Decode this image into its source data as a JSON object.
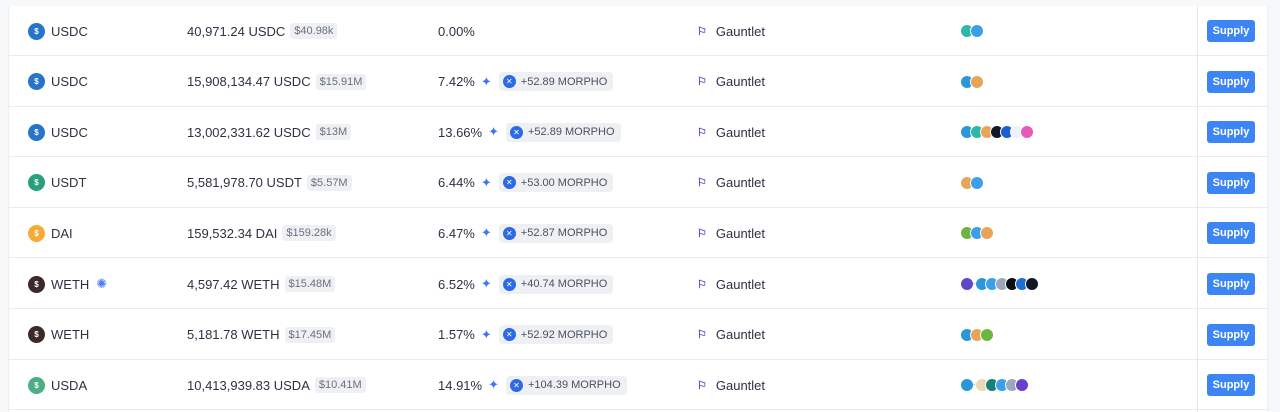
{
  "colors": {
    "accent": "#3d85f4",
    "usdc": "#2775ca",
    "usdt": "#26a17b",
    "dai": "#f5ac37",
    "weth": "#3c2a2a",
    "usda": "#4cae85",
    "morpho": "#2e6ae5",
    "curator": "#5a52d6"
  },
  "rows": [
    {
      "asset": {
        "symbol": "USDC",
        "icon": "usdc-icon",
        "color": "#2775ca",
        "extra_icon": null
      },
      "deposit": {
        "amount": "40,971.24 USDC",
        "usd": "$40.98k"
      },
      "apy": {
        "value": "0.00%",
        "sparkle": false,
        "reward": null
      },
      "curator": {
        "icon": "gauntlet-icon",
        "name": "Gauntlet"
      },
      "collateral": {
        "icons": [
          "#2fb7a7",
          "#3aa0ea"
        ],
        "more": false
      },
      "action_label": "Supply"
    },
    {
      "asset": {
        "symbol": "USDC",
        "icon": "usdc-icon",
        "color": "#2775ca",
        "extra_icon": null
      },
      "deposit": {
        "amount": "15,908,134.47 USDC",
        "usd": "$15.91M"
      },
      "apy": {
        "value": "7.42%",
        "sparkle": true,
        "reward": "+52.89 MORPHO"
      },
      "curator": {
        "icon": "gauntlet-icon",
        "name": "Gauntlet"
      },
      "collateral": {
        "icons": [
          "#2a97d8",
          "#e8a55a"
        ],
        "more": false
      },
      "action_label": "Supply"
    },
    {
      "asset": {
        "symbol": "USDC",
        "icon": "usdc-icon",
        "color": "#2775ca",
        "extra_icon": null
      },
      "deposit": {
        "amount": "13,002,331.62 USDC",
        "usd": "$13M"
      },
      "apy": {
        "value": "13.66%",
        "sparkle": true,
        "reward": "+52.89 MORPHO"
      },
      "curator": {
        "icon": "gauntlet-icon",
        "name": "Gauntlet"
      },
      "collateral": {
        "icons": [
          "#2a97d8",
          "#2fb7a7",
          "#e8a55a",
          "#101826",
          "#1d5fd1",
          "#eef3fb",
          "#e85ab8"
        ],
        "more": false
      },
      "action_label": "Supply"
    },
    {
      "asset": {
        "symbol": "USDT",
        "icon": "usdt-icon",
        "color": "#26a17b",
        "extra_icon": null
      },
      "deposit": {
        "amount": "5,581,978.70 USDT",
        "usd": "$5.57M"
      },
      "apy": {
        "value": "6.44%",
        "sparkle": true,
        "reward": "+53.00 MORPHO"
      },
      "curator": {
        "icon": "gauntlet-icon",
        "name": "Gauntlet"
      },
      "collateral": {
        "icons": [
          "#e8a55a",
          "#3aa0ea"
        ],
        "more": false
      },
      "action_label": "Supply"
    },
    {
      "asset": {
        "symbol": "DAI",
        "icon": "dai-icon",
        "color": "#f5ac37",
        "extra_icon": null
      },
      "deposit": {
        "amount": "159,532.34 DAI",
        "usd": "$159.28k"
      },
      "apy": {
        "value": "6.47%",
        "sparkle": true,
        "reward": "+52.87 MORPHO"
      },
      "curator": {
        "icon": "gauntlet-icon",
        "name": "Gauntlet"
      },
      "collateral": {
        "icons": [
          "#6cb640",
          "#3aa0ea",
          "#e8a55a"
        ],
        "more": false
      },
      "action_label": "Supply"
    },
    {
      "asset": {
        "symbol": "WETH",
        "icon": "weth-icon",
        "color": "#3c2a2a",
        "extra_icon": "sun-network-icon"
      },
      "deposit": {
        "amount": "4,597.42 WETH",
        "usd": "$15.48M"
      },
      "apy": {
        "value": "6.52%",
        "sparkle": true,
        "reward": "+40.74 MORPHO"
      },
      "curator": {
        "icon": "gauntlet-icon",
        "name": "Gauntlet"
      },
      "collateral": {
        "icons": [
          "#5b49c9",
          "#2a97d8",
          "#3aa0ea",
          "#9ba8bb",
          "#0b0e16",
          "#1d6fd1",
          "#101826"
        ],
        "more": true
      },
      "action_label": "Supply"
    },
    {
      "asset": {
        "symbol": "WETH",
        "icon": "weth-icon",
        "color": "#3c2a2a",
        "extra_icon": null
      },
      "deposit": {
        "amount": "5,181.78 WETH",
        "usd": "$17.45M"
      },
      "apy": {
        "value": "1.57%",
        "sparkle": true,
        "reward": "+52.92 MORPHO"
      },
      "curator": {
        "icon": "gauntlet-icon",
        "name": "Gauntlet"
      },
      "collateral": {
        "icons": [
          "#2a97d8",
          "#e8a55a",
          "#6cb640"
        ],
        "more": false
      },
      "action_label": "Supply"
    },
    {
      "asset": {
        "symbol": "USDA",
        "icon": "usda-icon",
        "color": "#4cae85",
        "extra_icon": null
      },
      "deposit": {
        "amount": "10,413,939.83 USDA",
        "usd": "$10.41M"
      },
      "apy": {
        "value": "14.91%",
        "sparkle": true,
        "reward": "+104.39 MORPHO"
      },
      "curator": {
        "icon": "gauntlet-icon",
        "name": "Gauntlet"
      },
      "collateral": {
        "icons": [
          "#2a97d8",
          "#e8d9b0",
          "#16807a",
          "#3aa0ea",
          "#9ba8bb",
          "#6a3fd0"
        ],
        "more": true
      },
      "action_label": "Supply"
    }
  ]
}
